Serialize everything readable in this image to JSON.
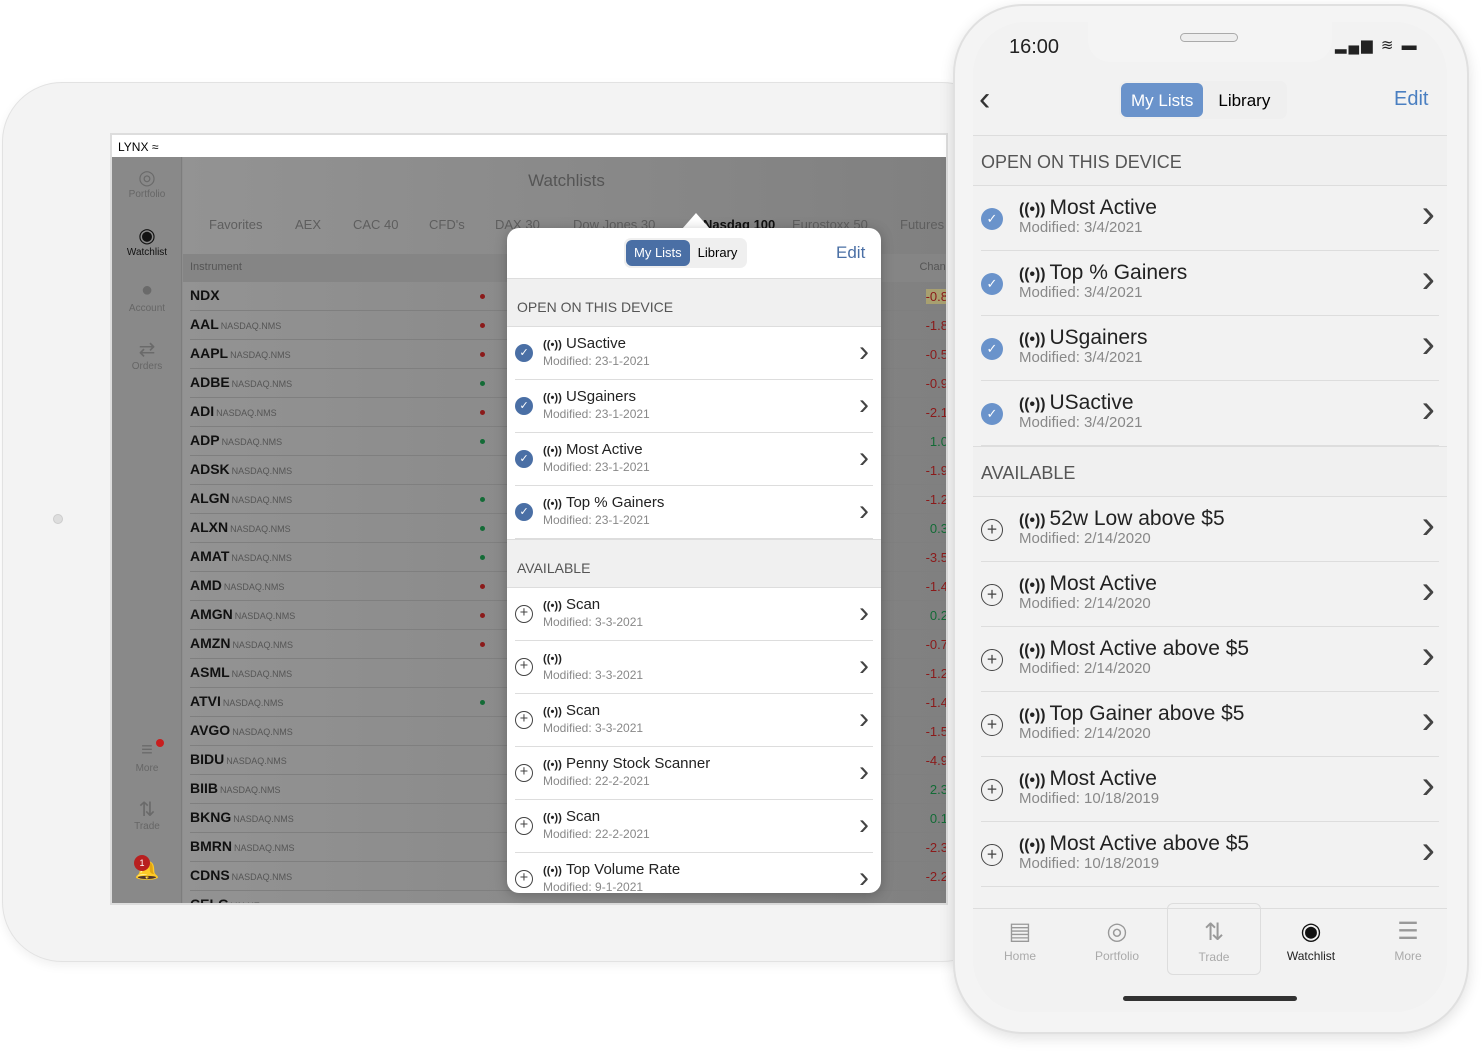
{
  "colors": {
    "accent": "#4a6fa5",
    "phone_accent": "#6a93cb",
    "negative": "#8b1a1a",
    "positive": "#136b36",
    "dim": "#8e8e8e"
  },
  "tablet": {
    "status_bar": {
      "carrier": "LYNX",
      "wifi_icon": "wifi-icon"
    },
    "sidebar": [
      {
        "label": "Portfolio",
        "icon": "portfolio-icon"
      },
      {
        "label": "Watchlist",
        "icon": "eye-icon",
        "active": true
      },
      {
        "label": "Account",
        "icon": "account-icon"
      },
      {
        "label": "Orders",
        "icon": "orders-icon"
      },
      {
        "label": "More",
        "icon": "menu-icon",
        "badge_dot": true
      },
      {
        "label": "Trade",
        "icon": "trade-icon"
      },
      {
        "label": "",
        "icon": "bell-icon",
        "badge": "1"
      }
    ],
    "title": "Watchlists",
    "tabs": [
      "Favorites",
      "AEX",
      "CAC 40",
      "CFD's",
      "DAX 30",
      "Dow Jones 30",
      "Nasdaq 100",
      "Eurostoxx 50",
      "Futures"
    ],
    "active_tab": "Nasdaq 100",
    "columns": [
      "Instrument",
      "Change"
    ],
    "rows": [
      {
        "symbol": "NDX",
        "exchange": "",
        "trend": "down",
        "change": "-0.8"
      },
      {
        "symbol": "AAL",
        "exchange": "NASDAQ.NMS",
        "trend": "down",
        "change": "-1.8"
      },
      {
        "symbol": "AAPL",
        "exchange": "NASDAQ.NMS",
        "trend": "down",
        "change": "-0.5"
      },
      {
        "symbol": "ADBE",
        "exchange": "NASDAQ.NMS",
        "trend": "up",
        "change": "-0.9"
      },
      {
        "symbol": "ADI",
        "exchange": "NASDAQ.NMS",
        "trend": "down",
        "change": "-2.1"
      },
      {
        "symbol": "ADP",
        "exchange": "NASDAQ.NMS",
        "trend": "up",
        "change": "1.0"
      },
      {
        "symbol": "ADSK",
        "exchange": "NASDAQ.NMS",
        "trend": "",
        "change": "-1.9"
      },
      {
        "symbol": "ALGN",
        "exchange": "NASDAQ.NMS",
        "trend": "up",
        "change": "-1.2"
      },
      {
        "symbol": "ALXN",
        "exchange": "NASDAQ.NMS",
        "trend": "up",
        "change": "0.3"
      },
      {
        "symbol": "AMAT",
        "exchange": "NASDAQ.NMS",
        "trend": "up",
        "change": "-3.5"
      },
      {
        "symbol": "AMD",
        "exchange": "NASDAQ.NMS",
        "trend": "down",
        "change": "-1.4"
      },
      {
        "symbol": "AMGN",
        "exchange": "NASDAQ.NMS",
        "trend": "down",
        "change": "0.2"
      },
      {
        "symbol": "AMZN",
        "exchange": "NASDAQ.NMS",
        "trend": "down",
        "change": "-0.7"
      },
      {
        "symbol": "ASML",
        "exchange": "NASDAQ.NMS",
        "trend": "",
        "change": "-1.2"
      },
      {
        "symbol": "ATVI",
        "exchange": "NASDAQ.NMS",
        "trend": "up",
        "change": "-1.4"
      },
      {
        "symbol": "AVGO",
        "exchange": "NASDAQ.NMS",
        "trend": "",
        "change": "-1.5"
      },
      {
        "symbol": "BIDU",
        "exchange": "NASDAQ.NMS",
        "trend": "",
        "change": "-4.9"
      },
      {
        "symbol": "BIIB",
        "exchange": "NASDAQ.NMS",
        "trend": "",
        "change": "2.3"
      },
      {
        "symbol": "BKNG",
        "exchange": "NASDAQ.NMS",
        "trend": "",
        "change": "0.1"
      },
      {
        "symbol": "BMRN",
        "exchange": "NASDAQ.NMS",
        "trend": "",
        "change": "-2.3"
      },
      {
        "symbol": "CDNS",
        "exchange": "NASDAQ.NMS",
        "trend": "",
        "change": "-2.2"
      },
      {
        "symbol": "CELG",
        "exchange": "VALUE",
        "trend": "",
        "change": ""
      }
    ],
    "popover": {
      "segments": [
        "My Lists",
        "Library"
      ],
      "selected": "My Lists",
      "edit": "Edit",
      "open_header": "OPEN ON THIS DEVICE",
      "available_header": "AVAILABLE",
      "open": [
        {
          "name": "USactive",
          "modified": "Modified: 23-1-2021"
        },
        {
          "name": "USgainers",
          "modified": "Modified: 23-1-2021"
        },
        {
          "name": "Most Active",
          "modified": "Modified: 23-1-2021"
        },
        {
          "name": "Top % Gainers",
          "modified": "Modified: 23-1-2021"
        }
      ],
      "available": [
        {
          "name": "Scan",
          "modified": "Modified: 3-3-2021"
        },
        {
          "name": "",
          "modified": "Modified: 3-3-2021"
        },
        {
          "name": "Scan",
          "modified": "Modified: 3-3-2021"
        },
        {
          "name": "Penny Stock Scanner",
          "modified": "Modified: 22-2-2021"
        },
        {
          "name": "Scan",
          "modified": "Modified: 22-2-2021"
        },
        {
          "name": "Top Volume Rate",
          "modified": "Modified: 9-1-2021"
        }
      ]
    }
  },
  "phone": {
    "time": "16:00",
    "status_icons": "signal-wifi-battery",
    "segments": [
      "My Lists",
      "Library"
    ],
    "selected": "My Lists",
    "edit": "Edit",
    "open_header": "OPEN ON THIS DEVICE",
    "available_header": "AVAILABLE",
    "open": [
      {
        "name": "Most Active",
        "modified": "Modified: 3/4/2021"
      },
      {
        "name": "Top % Gainers",
        "modified": "Modified: 3/4/2021"
      },
      {
        "name": "USgainers",
        "modified": "Modified: 3/4/2021"
      },
      {
        "name": "USactive",
        "modified": "Modified: 3/4/2021"
      }
    ],
    "available": [
      {
        "name": "52w Low above $5",
        "modified": "Modified: 2/14/2020"
      },
      {
        "name": "Most Active",
        "modified": "Modified: 2/14/2020"
      },
      {
        "name": "Most Active above $5",
        "modified": "Modified: 2/14/2020"
      },
      {
        "name": "Top Gainer above $5",
        "modified": "Modified: 2/14/2020"
      },
      {
        "name": "Most Active",
        "modified": "Modified: 10/18/2019"
      },
      {
        "name": "Most Active above $5",
        "modified": "Modified: 10/18/2019"
      }
    ],
    "tabbar": [
      {
        "label": "Home",
        "icon": "home-icon"
      },
      {
        "label": "Portfolio",
        "icon": "portfolio-icon"
      },
      {
        "label": "Trade",
        "icon": "trade-icon"
      },
      {
        "label": "Watchlist",
        "icon": "eye-icon",
        "active": true
      },
      {
        "label": "More",
        "icon": "menu-icon"
      }
    ]
  }
}
